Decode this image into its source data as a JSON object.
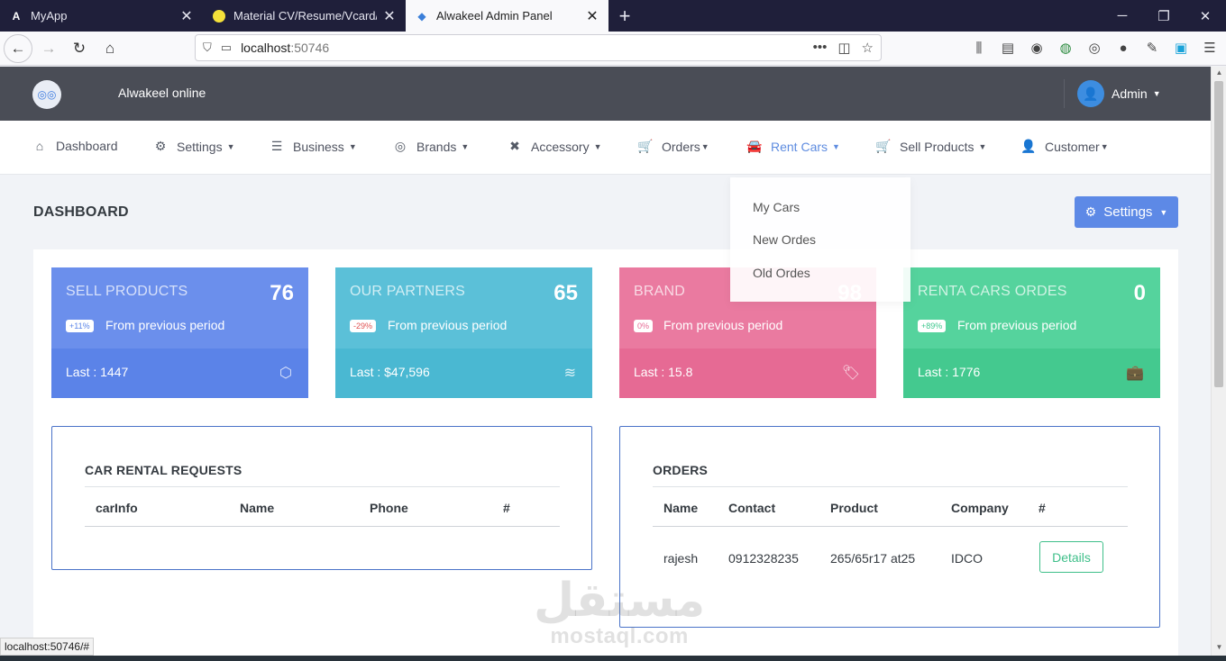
{
  "browser": {
    "tabs": [
      {
        "label": "MyApp",
        "icon": "angular-icon",
        "active": false
      },
      {
        "label": "Material CV/Resume/Vcard/Por",
        "icon": "circle-icon",
        "active": false
      },
      {
        "label": "Alwakeel Admin Panel",
        "icon": "diamond-icon",
        "active": true
      }
    ],
    "url_host": "localhost",
    "url_port": ":50746",
    "status_url": "localhost:50746/#"
  },
  "header": {
    "brand": "Alwakeel online",
    "user": "Admin"
  },
  "menu": [
    {
      "label": "Dashboard",
      "icon": "home-icon",
      "dropdown": false
    },
    {
      "label": "Settings",
      "icon": "gear-icon",
      "dropdown": true
    },
    {
      "label": "Business",
      "icon": "list-icon",
      "dropdown": true
    },
    {
      "label": "Brands",
      "icon": "globe-icon",
      "dropdown": true
    },
    {
      "label": "Accessory",
      "icon": "tools-icon",
      "dropdown": true
    },
    {
      "label": "Orders",
      "icon": "cart-icon",
      "dropdown": true
    },
    {
      "label": "Rent Cars",
      "icon": "car-icon",
      "dropdown": true
    },
    {
      "label": "Sell Products",
      "icon": "cart-plus-icon",
      "dropdown": true
    },
    {
      "label": "Customer",
      "icon": "user-gear-icon",
      "dropdown": true
    }
  ],
  "rent_cars_dropdown": [
    "My Cars",
    "New Ordes",
    "Old Ordes"
  ],
  "page": {
    "title": "DASHBOARD",
    "settings_button": "Settings"
  },
  "cards": [
    {
      "label": "SELL PRODUCTS",
      "value": "76",
      "badge": "+11%",
      "badge_color": "#5b85e8",
      "period": "From previous period",
      "last": "Last : 1447",
      "icon": "cube-icon",
      "top_color": "#6b8fec",
      "bottom_color": "#5b83e8"
    },
    {
      "label": "OUR PARTNERS",
      "value": "65",
      "badge": "-29%",
      "badge_color": "#e05252",
      "period": "From previous period",
      "last": "Last : $47,596",
      "icon": "layers-icon",
      "top_color": "#5bc0d8",
      "bottom_color": "#4ab8d2"
    },
    {
      "label": "BRAND",
      "value": "98",
      "badge": "0%",
      "badge_color": "#e66a94",
      "period": "From previous period",
      "last": "Last : 15.8",
      "icon": "tag-icon",
      "top_color": "#ea7aa0",
      "bottom_color": "#e66a94"
    },
    {
      "label": "RENTA CARS ORDES",
      "value": "0",
      "badge": "+89%",
      "badge_color": "#3fc78f",
      "period": "From previous period",
      "last": "Last : 1776",
      "icon": "briefcase-icon",
      "top_color": "#55d39d",
      "bottom_color": "#44c98f"
    }
  ],
  "car_rental_requests": {
    "title": "CAR RENTAL REQUESTS",
    "columns": [
      "carInfo",
      "Name",
      "Phone",
      "#"
    ],
    "rows": []
  },
  "orders": {
    "title": "ORDERS",
    "columns": [
      "Name",
      "Contact",
      "Product",
      "Company",
      "#"
    ],
    "rows": [
      {
        "name": "rajesh",
        "contact": "0912328235",
        "product": "265/65r17 at25",
        "company": "IDCO",
        "action": "Details"
      }
    ]
  },
  "watermark": {
    "arabic": "مستقل",
    "latin": "mostaql.com"
  }
}
